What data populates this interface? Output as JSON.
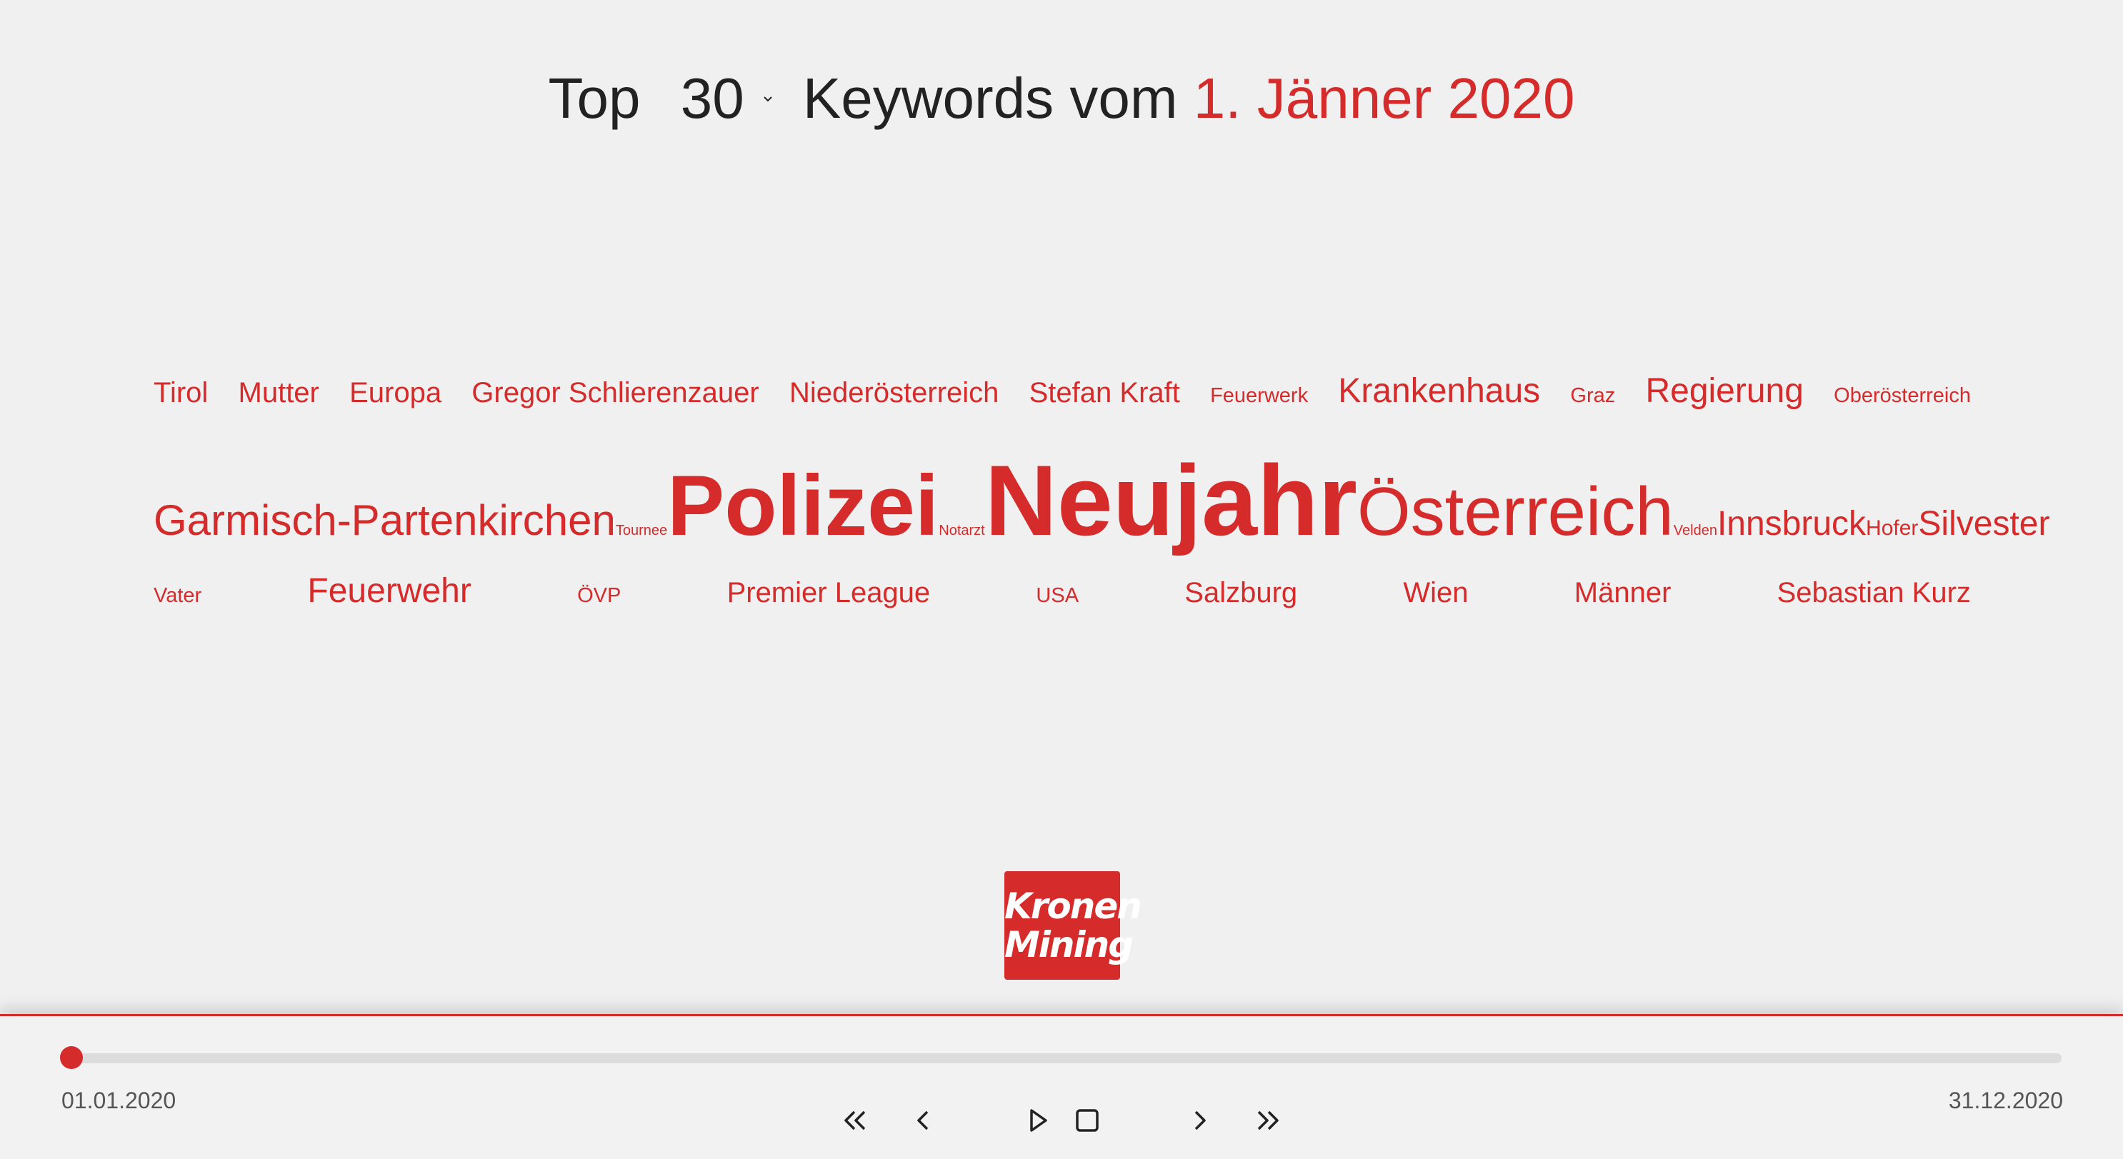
{
  "header": {
    "prefix": "Top",
    "count": "30",
    "middle": "Keywords vom",
    "date": "1. Jänner 2020"
  },
  "keywords": {
    "row1": [
      "Tirol",
      "Mutter",
      "Europa",
      "Gregor Schlierenzauer",
      "Niederösterreich",
      "Stefan Kraft",
      "Feuerwerk",
      "Krankenhaus",
      "Graz",
      "Regierung",
      "Oberösterreich"
    ],
    "row2": [
      "Garmisch-Partenkirchen",
      "Tournee",
      "Polizei",
      "Notarzt",
      "Neujahr",
      "Österreich",
      "Velden",
      "Innsbruck",
      "Hofer",
      "Silvester"
    ],
    "row3": [
      "Vater",
      "Feuerwehr",
      "ÖVP",
      "Premier League",
      "USA",
      "Salzburg",
      "Wien",
      "Männer",
      "Sebastian Kurz"
    ]
  },
  "logo": {
    "line1": "Kronen",
    "line2": "Mining"
  },
  "timeline": {
    "start": "01.01.2020",
    "end": "31.12.2020",
    "progress": 0
  },
  "icons": [
    "chevron-down-icon",
    "double-chevron-left-icon",
    "chevron-left-icon",
    "play-icon",
    "stop-icon",
    "chevron-right-icon",
    "double-chevron-right-icon"
  ],
  "colors": {
    "accent": "#d52b2b",
    "background": "#f0f0f0",
    "text": "#222222"
  }
}
